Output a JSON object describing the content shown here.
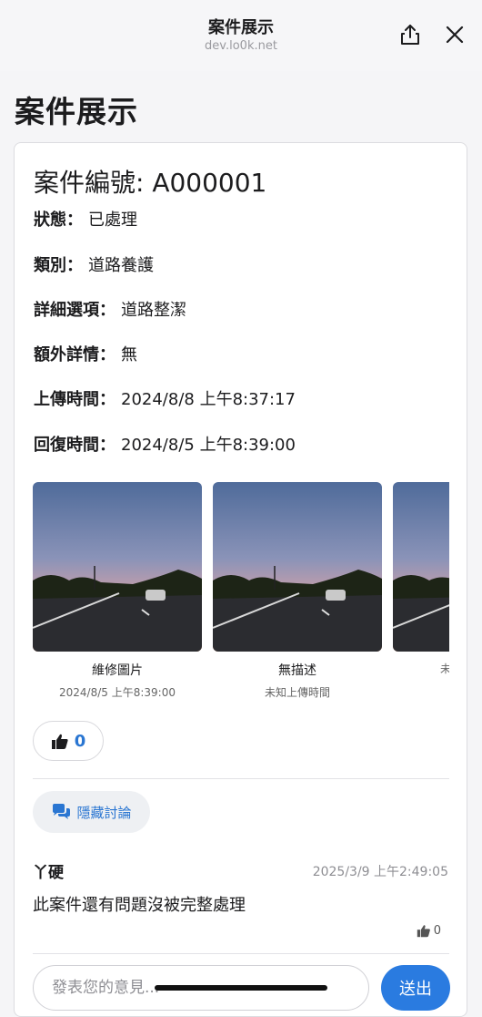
{
  "browser": {
    "title": "案件展示",
    "url": "dev.lo0k.net"
  },
  "page": {
    "title": "案件展示"
  },
  "case": {
    "number": "案件編號: A000001",
    "fields": [
      {
        "label": "狀態：",
        "value": "已處理"
      },
      {
        "label": "類別：",
        "value": "道路養護"
      },
      {
        "label": "詳細選項：",
        "value": "道路整潔"
      },
      {
        "label": "額外詳情：",
        "value": "無"
      },
      {
        "label": "上傳時間：",
        "value": "2024/8/8 上午8:37:17"
      },
      {
        "label": "回復時間：",
        "value": "2024/8/5 上午8:39:00"
      }
    ]
  },
  "gallery": [
    {
      "caption": "維修圖片",
      "time": "2024/8/5 上午8:39:00"
    },
    {
      "caption": "無描述",
      "time": "未知上傳時間"
    },
    {
      "caption": "",
      "time": "未"
    }
  ],
  "likes": {
    "count": "0"
  },
  "discussion": {
    "toggle_label": "隱藏討論"
  },
  "comments": [
    {
      "author": "丫硬",
      "time": "2025/3/9 上午2:49:05",
      "text": "此案件還有問題沒被完整處理",
      "likes": "0"
    }
  ],
  "composer": {
    "placeholder": "發表您的意見...",
    "send_label": "送出"
  },
  "colors": {
    "accent": "#2a7be0",
    "link": "#2a76d2"
  }
}
